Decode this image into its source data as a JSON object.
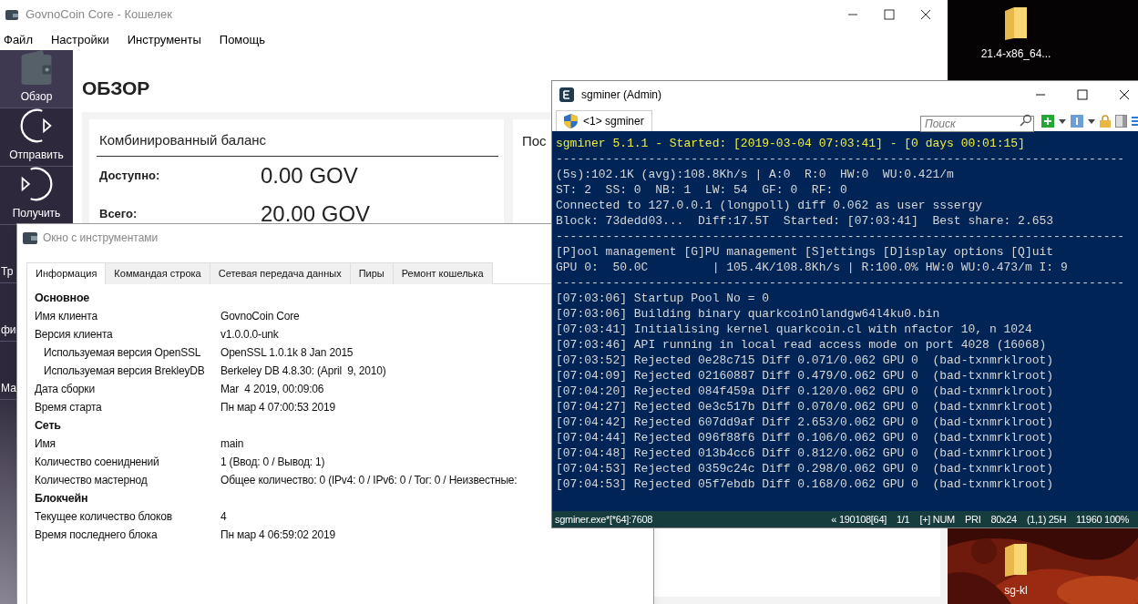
{
  "wallet": {
    "title": "GovnoCoin Core - Кошелек",
    "menu": [
      "Файл",
      "Настройки",
      "Инструменты",
      "Помощь"
    ],
    "nav": [
      {
        "label": "Обзор",
        "kind": "wallet",
        "selected": true
      },
      {
        "label": "Отправить",
        "kind": "send",
        "selected": false
      },
      {
        "label": "Получить",
        "kind": "receive",
        "selected": false
      },
      {
        "label": "Тр",
        "selected": false
      },
      {
        "label": "фи",
        "selected": false
      },
      {
        "label": "Ма",
        "selected": false
      }
    ],
    "heading": "ОБЗОР",
    "balance_card": {
      "title": "Комбинированный баланс",
      "rows": [
        {
          "label": "Доступно:",
          "value": "0.00 GOV"
        },
        {
          "label": "Всего:",
          "value": "20.00 GOV"
        }
      ]
    },
    "second_card": {
      "title": "Пос"
    }
  },
  "tools_window": {
    "title": "Окно с инструментами",
    "tabs": [
      {
        "label": "Информация",
        "selected": true
      },
      {
        "label": "Коммандая строка",
        "selected": false
      },
      {
        "label": "Сетевая передача данных",
        "selected": false
      },
      {
        "label": "Пиры",
        "selected": false
      },
      {
        "label": "Ремонт кошелька",
        "selected": false
      }
    ],
    "rows": [
      {
        "kind": "section",
        "label": "Основное"
      },
      {
        "kind": "field",
        "label": "Имя клиента",
        "value": "GovnoCoin Core"
      },
      {
        "kind": "field",
        "label": "Версия клиента",
        "value": "v1.0.0.0-unk"
      },
      {
        "kind": "subfield",
        "label": "Используемая версия OpenSSL",
        "value": "OpenSSL 1.0.1k 8 Jan 2015"
      },
      {
        "kind": "subfield",
        "label": "Используемая версия BrekleyDB",
        "value": "Berkeley DB 4.8.30: (April  9, 2010)"
      },
      {
        "kind": "field",
        "label": "Дата сборки",
        "value": "Mar  4 2019, 00:09:06"
      },
      {
        "kind": "field",
        "label": "Время старта",
        "value": "Пн мар 4 07:00:53 2019"
      },
      {
        "kind": "section",
        "label": "Сеть"
      },
      {
        "kind": "field",
        "label": "Имя",
        "value": "main"
      },
      {
        "kind": "field",
        "label": "Количество соениднений",
        "value": "1 (Ввод: 0 / Вывод: 1)"
      },
      {
        "kind": "field",
        "label": "Количество мастернод",
        "value": "Общее количество: 0 (IPv4: 0 / IPv6: 0 / Tor: 0 / Неизвестные:"
      },
      {
        "kind": "section",
        "label": "Блокчейн"
      },
      {
        "kind": "field",
        "label": "Текущее количество блоков",
        "value": "4"
      },
      {
        "kind": "field",
        "label": "Время последнего блока",
        "value": "Пн мар 4 06:59:02 2019"
      }
    ]
  },
  "console": {
    "title": "sgminer (Admin)",
    "tab": "<1> sgminer",
    "search": {
      "placeholder": "Поиск"
    },
    "lines": [
      {
        "kind": "highlight",
        "text": "sgminer 5.1.1 - Started: [2019-03-04 07:03:41] - [0 days 00:01:15]"
      },
      {
        "kind": "normal",
        "text": "--------------------------------------------------------------------------------"
      },
      {
        "kind": "normal",
        "text": "(5s):102.1K (avg):108.8Kh/s | A:0  R:0  HW:0  WU:0.421/m"
      },
      {
        "kind": "normal",
        "text": "ST: 2  SS: 0  NB: 1  LW: 54  GF: 0  RF: 0"
      },
      {
        "kind": "normal",
        "text": "Connected to 127.0.0.1 (longpoll) diff 0.062 as user sssergy"
      },
      {
        "kind": "normal",
        "text": "Block: 73dedd03...  Diff:17.5T  Started: [07:03:41]  Best share: 2.653"
      },
      {
        "kind": "normal",
        "text": "--------------------------------------------------------------------------------"
      },
      {
        "kind": "normal",
        "text": "[P]ool management [G]PU management [S]ettings [D]isplay options [Q]uit"
      },
      {
        "kind": "normal",
        "text": "GPU 0:  50.0C         | 105.4K/108.8Kh/s | R:100.0% HW:0 WU:0.473/m I: 9"
      },
      {
        "kind": "normal",
        "text": "--------------------------------------------------------------------------------"
      },
      {
        "kind": "normal",
        "text": "[07:03:06] Startup Pool No = 0"
      },
      {
        "kind": "normal",
        "text": "[07:03:06] Building binary quarkcoinOlandgw64l4ku0.bin"
      },
      {
        "kind": "normal",
        "text": "[07:03:41] Initialising kernel quarkcoin.cl with nfactor 10, n 1024"
      },
      {
        "kind": "normal",
        "text": "[07:03:46] API running in local read access mode on port 4028 (16068)"
      },
      {
        "kind": "normal",
        "text": "[07:03:52] Rejected 0e28c715 Diff 0.071/0.062 GPU 0  (bad-txnmrklroot)"
      },
      {
        "kind": "normal",
        "text": "[07:04:09] Rejected 02160887 Diff 0.479/0.062 GPU 0  (bad-txnmrklroot)"
      },
      {
        "kind": "normal",
        "text": "[07:04:20] Rejected 084f459a Diff 0.120/0.062 GPU 0  (bad-txnmrklroot)"
      },
      {
        "kind": "normal",
        "text": "[07:04:27] Rejected 0e3c517b Diff 0.070/0.062 GPU 0  (bad-txnmrklroot)"
      },
      {
        "kind": "normal",
        "text": "[07:04:42] Rejected 607dd9af Diff 2.653/0.062 GPU 0  (bad-txnmrklroot)"
      },
      {
        "kind": "normal",
        "text": "[07:04:44] Rejected 096f88f6 Diff 0.106/0.062 GPU 0  (bad-txnmrklroot)"
      },
      {
        "kind": "normal",
        "text": "[07:04:48] Rejected 013b4cc6 Diff 0.812/0.062 GPU 0  (bad-txnmrklroot)"
      },
      {
        "kind": "normal",
        "text": "[07:04:53] Rejected 0359c24c Diff 0.298/0.062 GPU 0  (bad-txnmrklroot)"
      },
      {
        "kind": "normal",
        "text": "[07:04:53] Rejected 05f7ebdb Diff 0.168/0.062 GPU 0  (bad-txnmrklroot)"
      }
    ],
    "status_bar": {
      "process": "sgminer.exe*[*64]:7608",
      "fields": [
        "« 190108[64]",
        "1/1",
        "[+] NUM",
        "PRI",
        "80x24",
        "(1,1) 25H",
        "11960 100%"
      ]
    }
  },
  "desktop": {
    "icons": [
      {
        "label": "21.4-x86_64..."
      },
      {
        "label": "sg-kl"
      }
    ]
  }
}
